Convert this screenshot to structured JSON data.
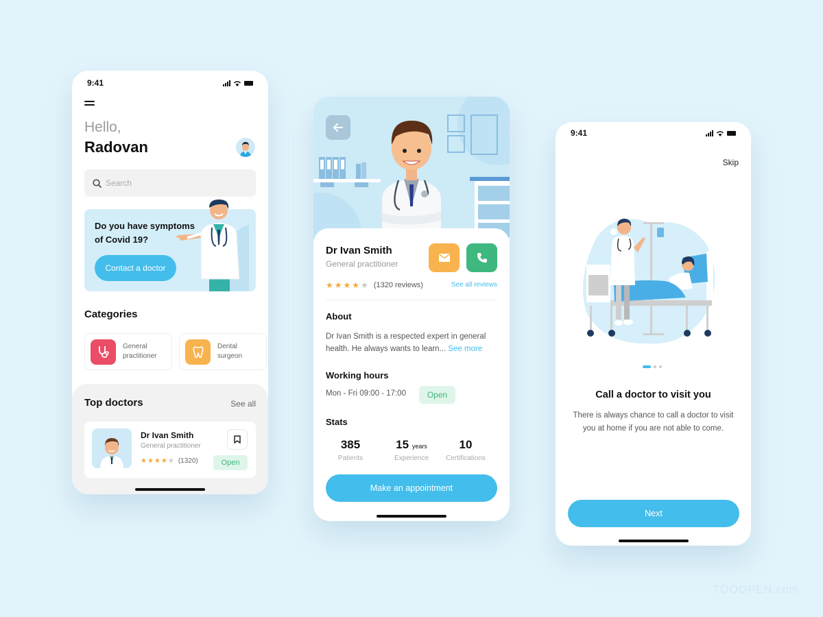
{
  "colors": {
    "background": "#e2f3fb",
    "accent": "#43bdeb",
    "open_green": "#3fb57b",
    "open_bg": "#dff5ea",
    "star": "#f5a83b",
    "category_red": "#ea4d65",
    "category_orange": "#f8b24e",
    "call_green": "#3fb880"
  },
  "home_screen": {
    "status_time": "9:41",
    "menu_icon": "hamburger-icon",
    "greeting": "Hello,",
    "user_name": "Radovan",
    "search_placeholder": "Search",
    "banner": {
      "title": "Do you have symptoms of Covid 19?",
      "button_label": "Contact a doctor"
    },
    "categories_title": "Categories",
    "categories": [
      {
        "label": "General practitioner",
        "icon": "stethoscope-icon"
      },
      {
        "label": "Dental surgeon",
        "icon": "tooth-icon"
      }
    ],
    "top_doctors_title": "Top doctors",
    "see_all_label": "See all",
    "doctor_card": {
      "name": "Dr Ivan Smith",
      "specialty": "General practitioner",
      "rating": 4,
      "rating_max": 5,
      "reviews": "(1320)",
      "status": "Open"
    }
  },
  "doctor_screen": {
    "back_icon": "arrow-left-icon",
    "name": "Dr Ivan Smith",
    "specialty": "General practitioner",
    "rating": 4,
    "rating_max": 5,
    "reviews": "(1320 reviews)",
    "see_all_reviews": "See all reviews",
    "about_title": "About",
    "about_text": "Dr Ivan Smith is a respected expert in general health. He always wants to learn... ",
    "see_more": "See more",
    "working_hours_title": "Working hours",
    "working_hours": "Mon - Fri 09:00 - 17:00",
    "status": "Open",
    "stats_title": "Stats",
    "stats": [
      {
        "value": "385",
        "unit": "",
        "label": "Patients"
      },
      {
        "value": "15",
        "unit": "years",
        "label": "Experience"
      },
      {
        "value": "10",
        "unit": "",
        "label": "Certifications"
      }
    ],
    "appointment_button": "Make an appointment"
  },
  "onboarding_screen": {
    "status_time": "9:41",
    "skip_label": "Skip",
    "page_index": 1,
    "page_count": 3,
    "title": "Call a doctor to visit you",
    "text": "There is always chance to call a doctor to visit you at home if you are not able to come.",
    "next_button": "Next"
  },
  "watermark": "TOOOPEN.com"
}
